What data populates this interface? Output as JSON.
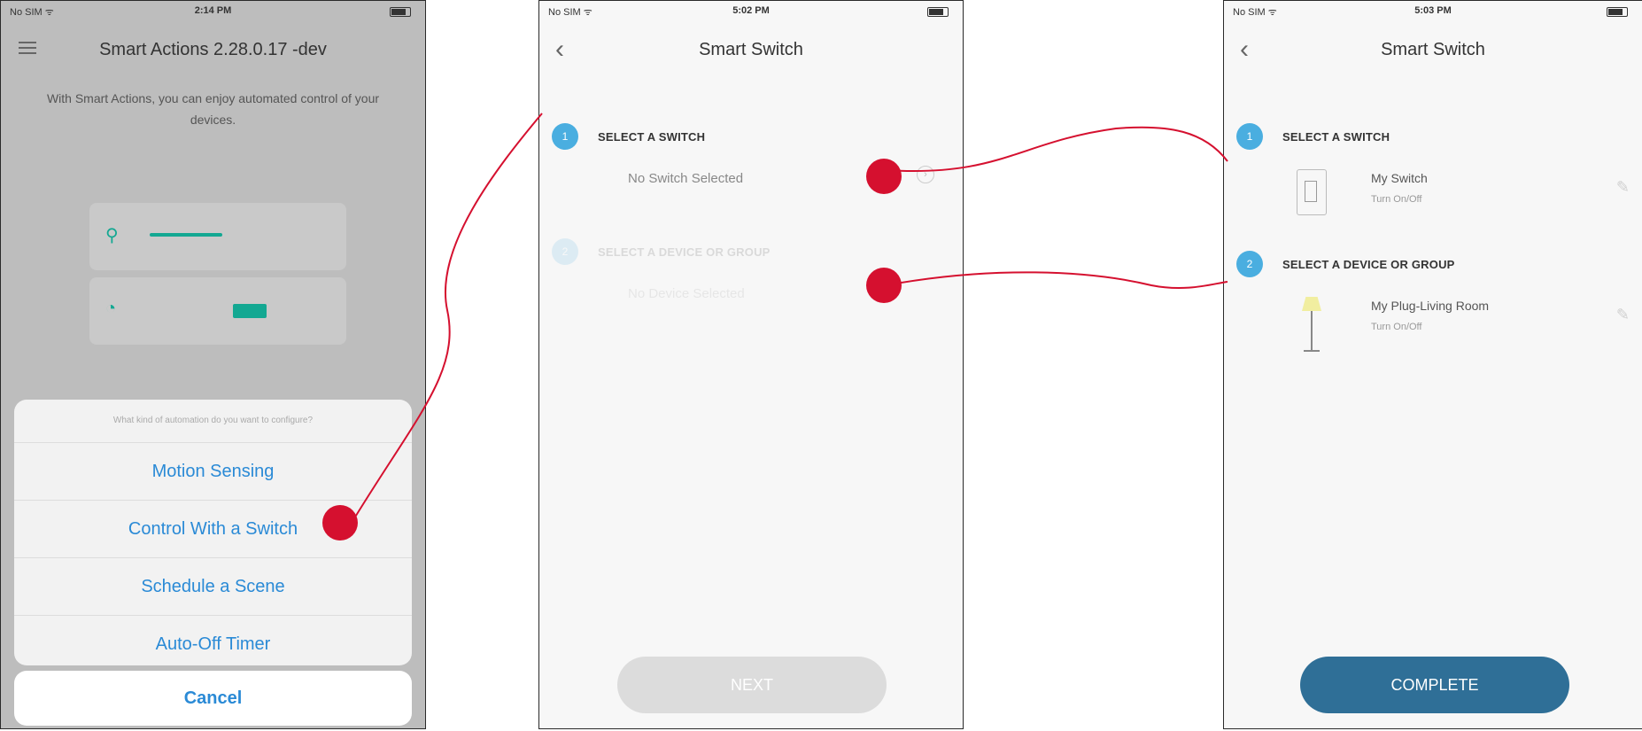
{
  "phones": [
    {
      "status": {
        "carrier": "No SIM ᯤ",
        "time": "2:14 PM"
      },
      "title": "Smart Actions 2.28.0.17 -dev",
      "subtitle": "With Smart Actions, you can enjoy automated control of your devices.",
      "sheet": {
        "prompt": "What kind of automation do you want to configure?",
        "options": [
          "Motion Sensing",
          "Control With a Switch",
          "Schedule a Scene",
          "Auto-Off Timer"
        ],
        "cancel": "Cancel"
      }
    },
    {
      "status": {
        "carrier": "No SIM ᯤ",
        "time": "5:02 PM"
      },
      "title": "Smart Switch",
      "step1": {
        "num": "1",
        "title": "SELECT A SWITCH",
        "value": "No Switch Selected"
      },
      "step2": {
        "num": "2",
        "title": "SELECT A DEVICE OR GROUP",
        "value": "No Device Selected"
      },
      "button": "NEXT"
    },
    {
      "status": {
        "carrier": "No SIM ᯤ",
        "time": "5:03 PM"
      },
      "title": "Smart Switch",
      "step1": {
        "num": "1",
        "title": "SELECT A SWITCH",
        "device": "My Switch",
        "status": "Turn On/Off"
      },
      "step2": {
        "num": "2",
        "title": "SELECT A DEVICE OR GROUP",
        "device": "My Plug-Living Room",
        "status": "Turn On/Off"
      },
      "button": "COMPLETE"
    }
  ],
  "icons": {
    "back": "‹",
    "chevron": "›",
    "pencil": "✎",
    "motion": "⚲",
    "timer": "◔"
  },
  "colors": {
    "marker": "#d5102f",
    "accent": "#2a8ad6",
    "teal": "#13a892",
    "complete": "#2f6f97"
  }
}
